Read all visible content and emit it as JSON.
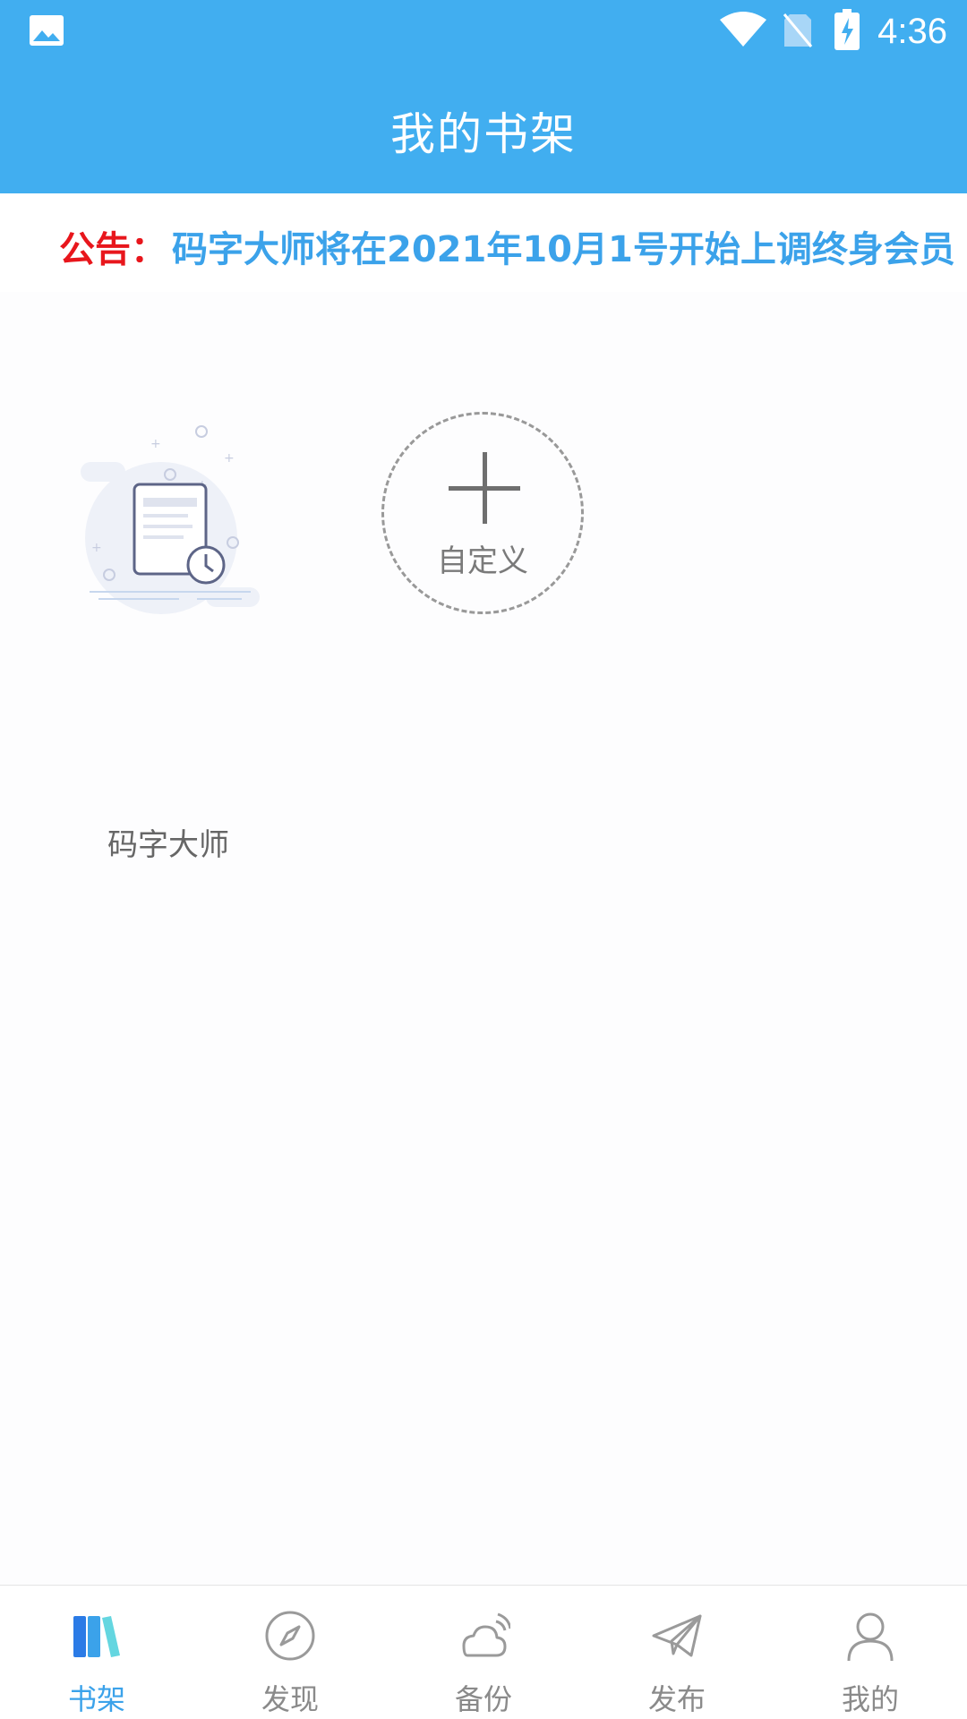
{
  "status_bar": {
    "time": "4:36",
    "icons": [
      "gallery-icon",
      "wifi-icon",
      "no-sim-icon",
      "battery-charging-icon"
    ]
  },
  "header": {
    "title": "我的书架"
  },
  "notice": {
    "label": "公告：",
    "text": "码字大师将在2021年10月1号开始上调终身会员"
  },
  "shelf": {
    "books": [
      {
        "title": "码字大师",
        "icon": "document-clock-icon"
      }
    ],
    "add_custom": {
      "label": "自定义",
      "icon": "plus-icon"
    }
  },
  "bottom_nav": {
    "items": [
      {
        "label": "书架",
        "icon": "bookshelf-icon",
        "active": true
      },
      {
        "label": "发现",
        "icon": "compass-icon",
        "active": false
      },
      {
        "label": "备份",
        "icon": "cloud-backup-icon",
        "active": false
      },
      {
        "label": "发布",
        "icon": "paper-plane-icon",
        "active": false
      },
      {
        "label": "我的",
        "icon": "user-icon",
        "active": false
      }
    ]
  },
  "colors": {
    "accent": "#41aef0",
    "notice_label": "#e8161c",
    "notice_text": "#3ba2ea",
    "active_tab": "#3ba2ea"
  }
}
